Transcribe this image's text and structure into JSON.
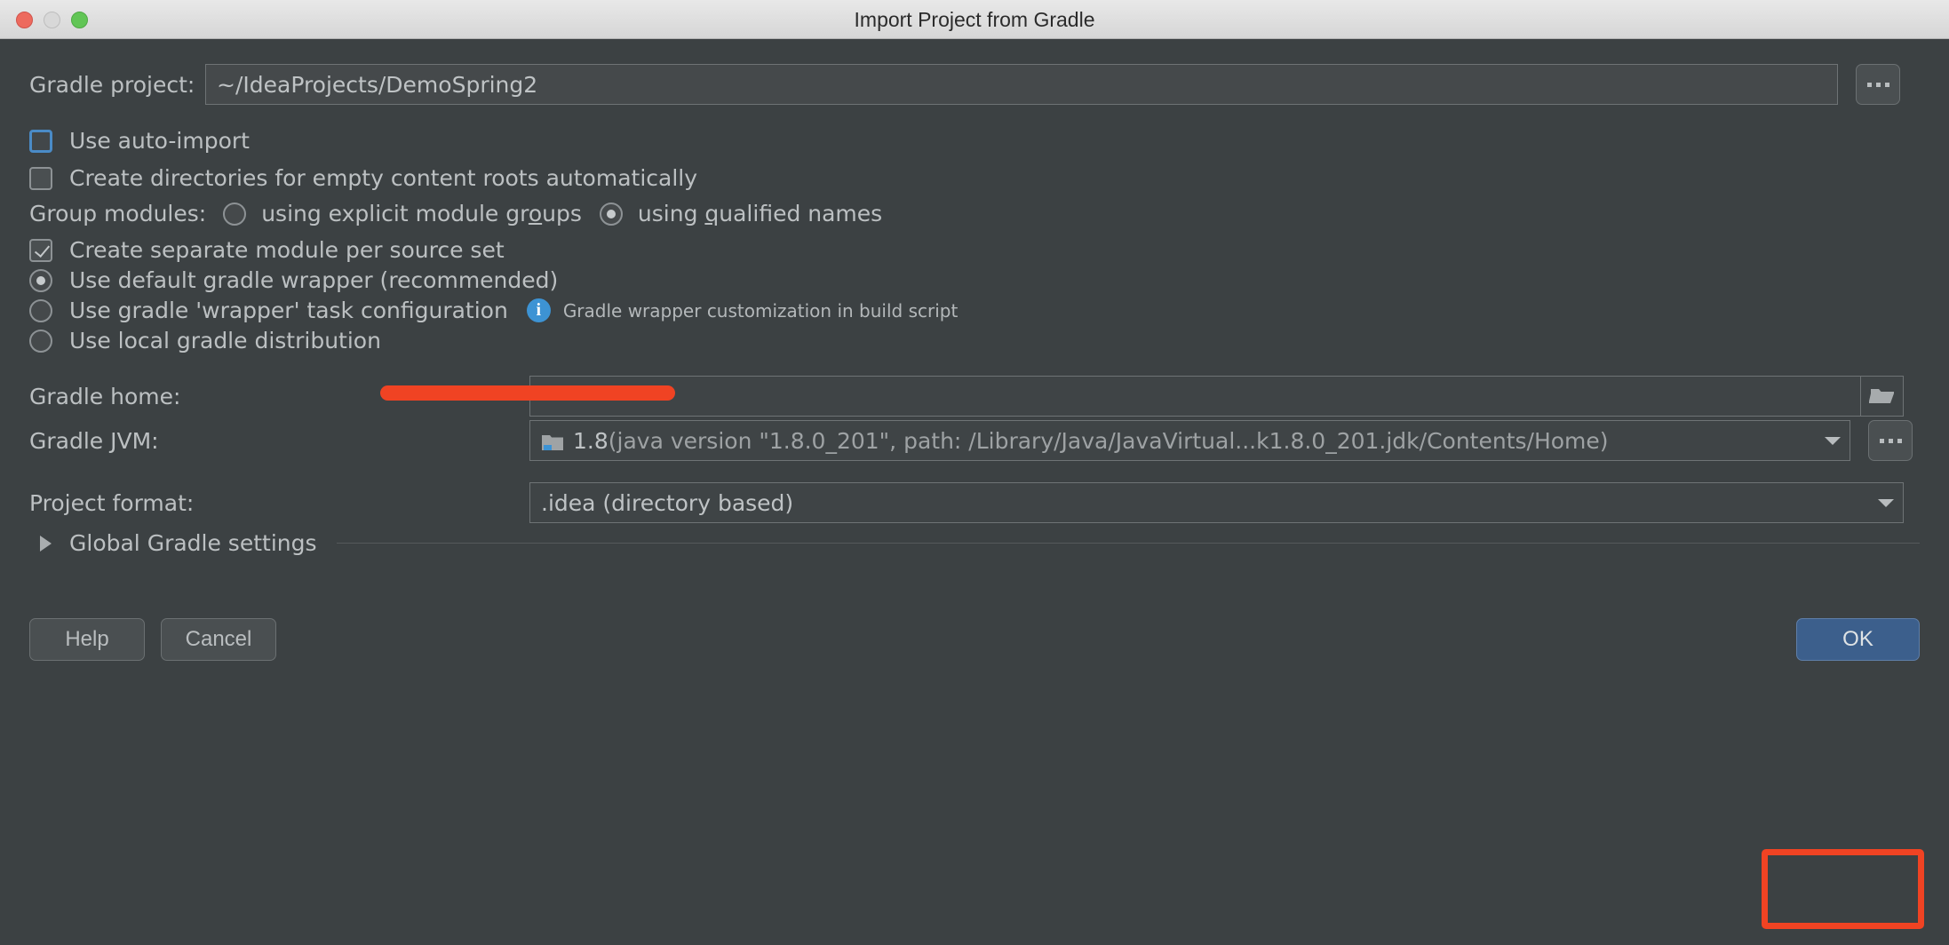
{
  "window": {
    "title": "Import Project from Gradle",
    "traffic_lights": [
      "close-red",
      "minimize-yellow",
      "zoom-green"
    ]
  },
  "form": {
    "gradle_project": {
      "label": "Gradle project:",
      "value": "~/IdeaProjects/DemoSpring2",
      "browse_label": "..."
    },
    "use_auto_import": {
      "label": "Use auto-import",
      "checked": false,
      "focused": true
    },
    "create_directories": {
      "label": "Create directories for empty content roots automatically",
      "checked": false,
      "focused": false
    },
    "group_modules": {
      "label": "Group modules:",
      "options": [
        {
          "label_pre": "using explicit module gr",
          "mnemonic": "o",
          "label_post": "ups",
          "selected": false
        },
        {
          "label_pre": "using ",
          "mnemonic": "q",
          "label_post": "ualified names",
          "selected": true
        }
      ]
    },
    "create_separate_module": {
      "label": "Create separate module per source set",
      "checked": true
    },
    "gradle_distribution": {
      "options": [
        {
          "label": "Use default gradle wrapper (recommended)",
          "selected": true
        },
        {
          "label": "Use gradle 'wrapper' task configuration",
          "selected": false,
          "hint": "Gradle wrapper customization in build script"
        },
        {
          "label": "Use local gradle distribution",
          "selected": false
        }
      ]
    },
    "gradle_home": {
      "label": "Gradle home:",
      "value": "",
      "browse_icon": "folder-open-icon"
    },
    "gradle_jvm": {
      "label": "Gradle JVM:",
      "value_main": "1.8",
      "value_detail": " (java version \"1.8.0_201\", path: /Library/Java/JavaVirtual...k1.8.0_201.jdk/Contents/Home)",
      "browse_label": "..."
    },
    "project_format": {
      "label": "Project format:",
      "value": ".idea (directory based)"
    },
    "global_gradle_settings": {
      "label": "Global Gradle settings",
      "expanded": false
    }
  },
  "footer": {
    "help_label": "Help",
    "cancel_label": "Cancel",
    "ok_label": "OK"
  },
  "annotations": {
    "ok_highlight_color": "#f04323",
    "jvm_underline_color": "#f04323"
  }
}
